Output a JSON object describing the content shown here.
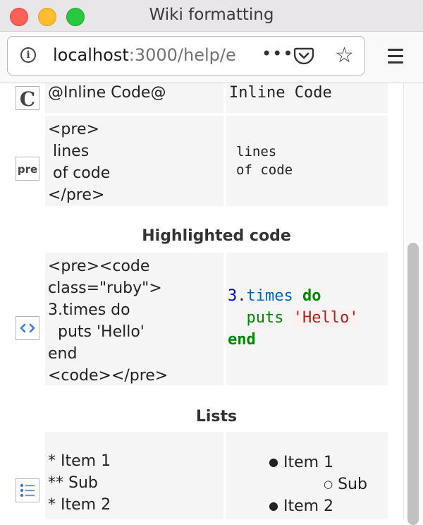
{
  "window": {
    "title": "Wiki formatting"
  },
  "toolbar": {
    "url_host": "localhost",
    "url_path": ":3000/help/e",
    "more_label": "•••"
  },
  "rows": {
    "inline_code": {
      "source": "@Inline Code@",
      "result": "Inline Code",
      "icon": "inline-code-icon"
    },
    "pre": {
      "source": "<pre>\n lines\n of code\n</pre>",
      "result": "lines\nof code",
      "icon": "pre-icon"
    },
    "highlighted": {
      "heading": "Highlighted code",
      "source": "<pre><code\nclass=\"ruby\">\n3.times do\n  puts 'Hello'\nend\n<code></pre>",
      "result": {
        "num": "3",
        "dot": ".",
        "meth": "times",
        "kw_do": "do",
        "puts": "puts",
        "str": "'Hello'",
        "kw_end": "end"
      },
      "icon": "code-brackets-icon"
    },
    "lists": {
      "heading": "Lists",
      "source": "* Item 1\n** Sub\n* Item 2",
      "items": [
        "Item 1",
        "Sub",
        "Item 2"
      ],
      "icon": "list-icon"
    }
  },
  "colors": {
    "cell_bg": "#f5f5f5",
    "keyword_green": "#008800",
    "number_blue": "#0000cc",
    "string_red": "#aa2222"
  }
}
